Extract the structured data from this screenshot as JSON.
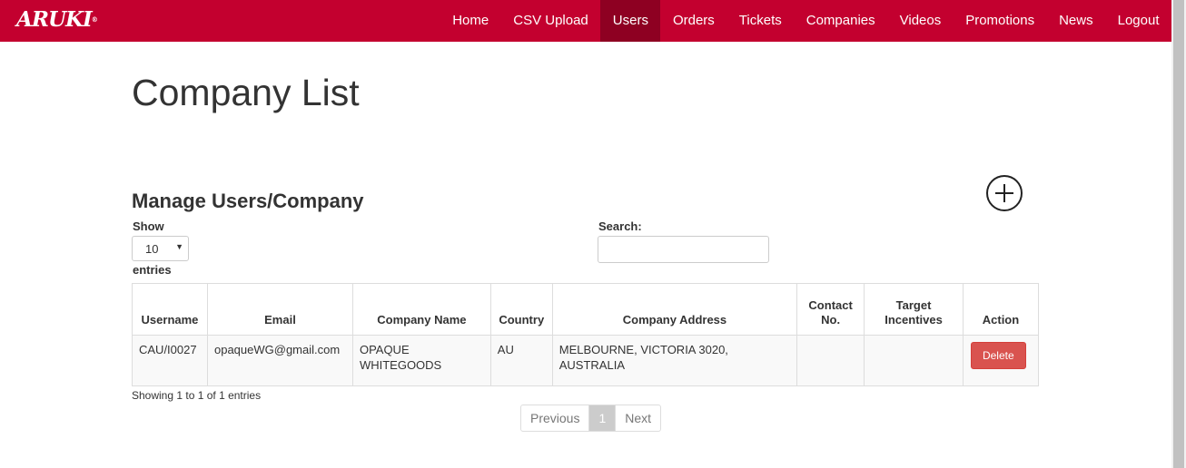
{
  "brand": {
    "logo_text": "ARUKI",
    "logo_mark": "®"
  },
  "nav": {
    "items": [
      {
        "label": "Home"
      },
      {
        "label": "CSV Upload"
      },
      {
        "label": "Users"
      },
      {
        "label": "Orders"
      },
      {
        "label": "Tickets"
      },
      {
        "label": "Companies"
      },
      {
        "label": "Videos"
      },
      {
        "label": "Promotions"
      },
      {
        "label": "News"
      },
      {
        "label": "Logout"
      }
    ],
    "active": "Users"
  },
  "page": {
    "title": "Company List"
  },
  "section": {
    "title": "Manage Users/Company",
    "add_icon": "plus-circle-icon"
  },
  "controls": {
    "show_label": "Show",
    "length_value": "10",
    "entries_label": "entries",
    "search_label": "Search:",
    "search_value": ""
  },
  "table": {
    "columns": [
      "Username",
      "Email",
      "Company Name",
      "Country",
      "Company Address",
      "Contact No.",
      "Target Incentives",
      "Action"
    ],
    "rows": [
      {
        "username": "CAU/I0027",
        "email": "opaqueWG@gmail.com",
        "company_name": "OPAQUE WHITEGOODS",
        "country": "AU",
        "company_address": "MELBOURNE, VICTORIA 3020, AUSTRALIA",
        "contact_no": "",
        "target_incentives": "",
        "action_label": "Delete"
      }
    ]
  },
  "footer": {
    "info": "Showing 1 to 1 of 1 entries",
    "prev": "Previous",
    "current_page": "1",
    "next": "Next"
  },
  "colors": {
    "brand": "#c3002f",
    "nav_active": "#8e0022",
    "danger": "#d9534f"
  }
}
